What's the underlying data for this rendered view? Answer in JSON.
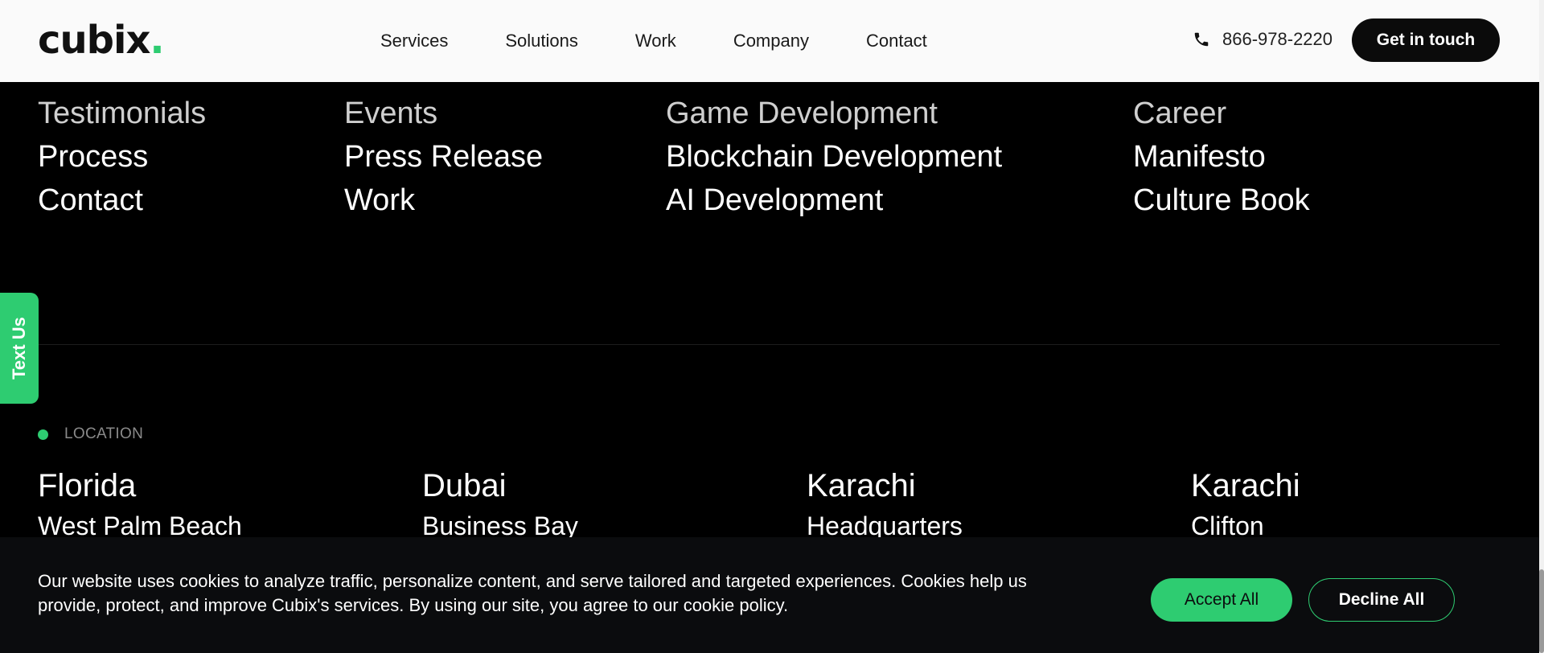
{
  "header": {
    "logo": {
      "text": "cubix",
      "dot": "."
    },
    "nav": [
      {
        "label": "Services"
      },
      {
        "label": "Solutions"
      },
      {
        "label": "Work"
      },
      {
        "label": "Company"
      },
      {
        "label": "Contact"
      }
    ],
    "phone": "866-978-2220",
    "cta_label": "Get in touch"
  },
  "link_columns": [
    {
      "cut_off": "Testimonials",
      "items": [
        "Process",
        "Contact"
      ]
    },
    {
      "cut_off": "Events",
      "items": [
        "Press Release",
        "Work"
      ]
    },
    {
      "cut_off": "Game Development",
      "items": [
        "Blockchain Development",
        "AI Development"
      ]
    },
    {
      "cut_off": "Career",
      "items": [
        "Manifesto",
        "Culture Book"
      ]
    }
  ],
  "text_us": "Text Us",
  "location": {
    "label": "LOCATION",
    "cities": [
      {
        "name": "Florida",
        "area": "West Palm Beach"
      },
      {
        "name": "Dubai",
        "area": "Business Bay"
      },
      {
        "name": "Karachi",
        "area": "Headquarters"
      },
      {
        "name": "Karachi",
        "area": "Clifton"
      }
    ]
  },
  "cookie_banner": {
    "text": "Our website uses cookies to analyze traffic, personalize content, and serve tailored and targeted experiences. Cookies help us provide, protect, and improve Cubix's services. By using our site, you agree to our cookie policy.",
    "accept_label": "Accept All",
    "decline_label": "Decline All"
  },
  "colors": {
    "accent": "#2ecc71",
    "background": "#000000",
    "header_bg": "#fafafa",
    "cookie_bg": "#0b0c0e"
  }
}
